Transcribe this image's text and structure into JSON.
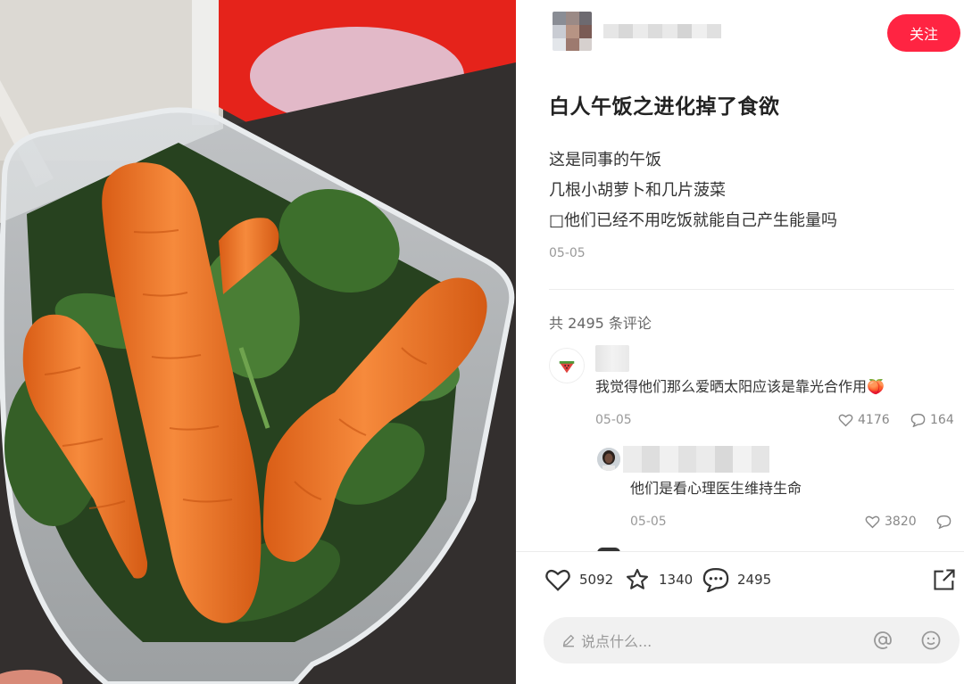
{
  "author": {
    "follow_label": "关注"
  },
  "post": {
    "title": "白人午饭之进化掉了食欲",
    "lines": [
      "这是同事的午饭",
      "几根小胡萝卜和几片菠菜",
      "□他们已经不用吃饭就能自己产生能量吗"
    ],
    "date": "05-05"
  },
  "comments": {
    "total_label": "共 2495 条评论",
    "items": [
      {
        "avatar_icon": "watermelon-icon",
        "text": "我觉得他们那么爱晒太阳应该是靠光合作用🍑",
        "date": "05-05",
        "likes": "4176",
        "replies": "164"
      },
      {
        "avatar_icon": "person-photo",
        "text": "他们是看心理医生维持生命",
        "date": "05-05",
        "likes": "3820",
        "replies": ""
      }
    ]
  },
  "actions": {
    "likes": "5092",
    "favorites": "1340",
    "comments": "2495"
  },
  "input": {
    "placeholder": "说点什么..."
  },
  "colors": {
    "accent": "#ff2442",
    "carrot": "#f07a2c",
    "spinach": "#2f5a24"
  }
}
